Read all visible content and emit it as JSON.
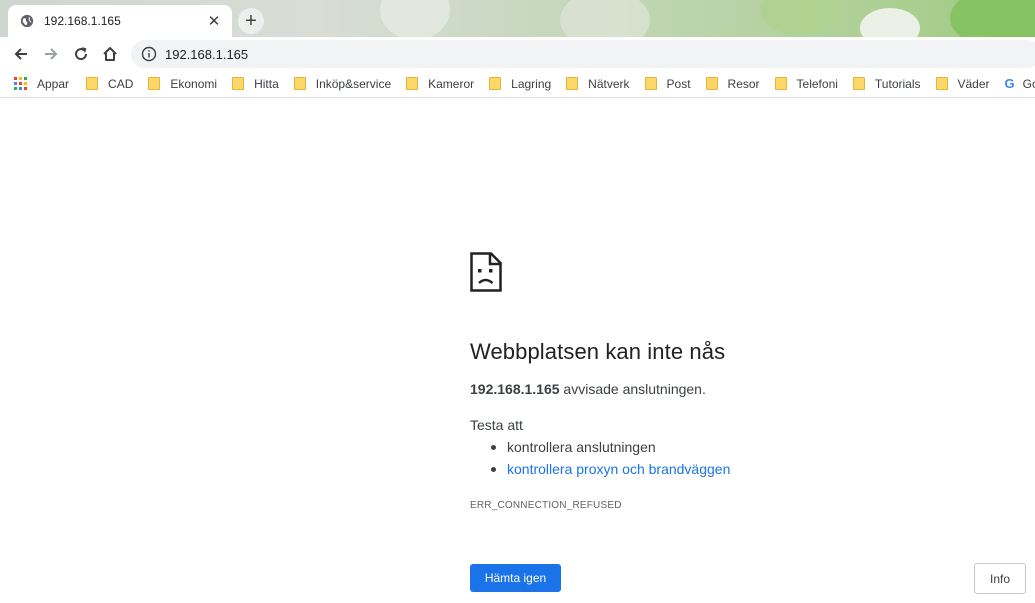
{
  "tab": {
    "title": "192.168.1.165",
    "icon": "globe-icon",
    "close_glyph": "✕",
    "new_tab_glyph": "+"
  },
  "toolbar": {
    "back_icon": "back-arrow-icon",
    "forward_icon": "forward-arrow-icon",
    "reload_icon": "reload-icon",
    "home_icon": "home-icon",
    "address": "192.168.1.165",
    "address_icon": "info-icon"
  },
  "bookmarks": {
    "apps_label": "Appar",
    "folders": [
      "CAD",
      "Ekonomi",
      "Hitta",
      "Inköp&service",
      "Kameror",
      "Lagring",
      "Nätverk",
      "Post",
      "Resor",
      "Telefoni",
      "Tutorials",
      "Väder"
    ],
    "google_label": "Google",
    "google_glyph": "G"
  },
  "error": {
    "icon": "sad-page-icon",
    "heading": "Webbplatsen kan inte nås",
    "host": "192.168.1.165",
    "summary_rest": " avvisade anslutningen.",
    "try_label": "Testa att",
    "suggestions": [
      "kontrollera anslutningen",
      "kontrollera proxyn och brandväggen"
    ],
    "code": "ERR_CONNECTION_REFUSED",
    "reload_label": "Hämta igen",
    "details_label": "Info"
  },
  "colors": {
    "accent": "#1a73e8",
    "folder": "#fcd667",
    "text": "#202124"
  }
}
